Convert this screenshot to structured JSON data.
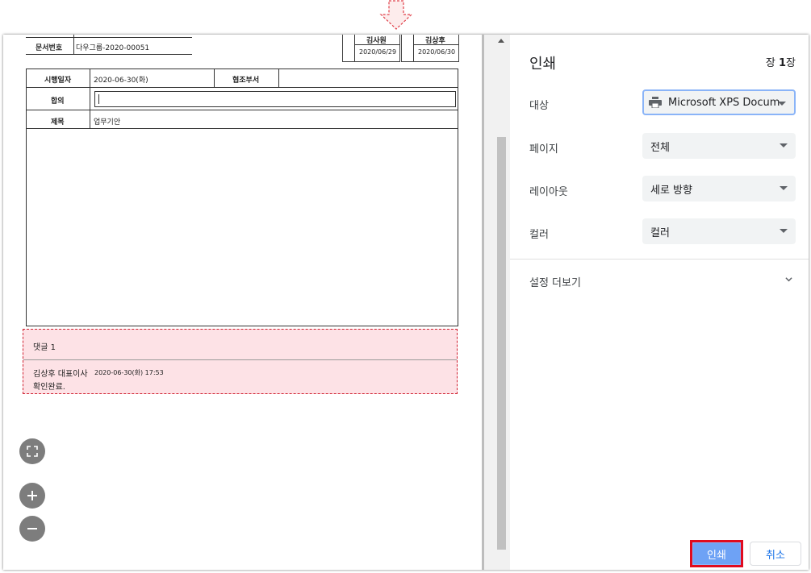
{
  "document": {
    "doc_number_label": "문서번호",
    "doc_number_value": "다우그룹-2020-00051",
    "approvers": [
      {
        "name": "김사원",
        "date": "2020/06/29"
      },
      {
        "name": "김상후",
        "date": "2020/06/30"
      }
    ],
    "exec_date_label": "시행일자",
    "exec_date_value": "2020-06-30(화)",
    "coop_dept_label": "협조부서",
    "agree_label": "합의",
    "title_label": "제목",
    "title_value": "업무기안",
    "comment": {
      "header": "댓글 1",
      "author": "김상후 대표이사",
      "timestamp": "2020-06-30(화) 17:53",
      "text": "확인완료."
    }
  },
  "panel": {
    "title": "인쇄",
    "page_count_prefix": "장",
    "page_count_number": "1",
    "page_count_suffix": "장",
    "rows": [
      {
        "label": "대상",
        "value": "Microsoft XPS Docum"
      },
      {
        "label": "페이지",
        "value": "전체"
      },
      {
        "label": "레이아웃",
        "value": "세로 방향"
      },
      {
        "label": "컬러",
        "value": "컬러"
      }
    ],
    "more_settings": "설정 더보기",
    "print_button": "인쇄",
    "cancel_button": "취소"
  },
  "colors": {
    "accent": "#8ab4f8",
    "highlight_border": "#e00b1f",
    "comment_bg": "#fde2e6"
  }
}
